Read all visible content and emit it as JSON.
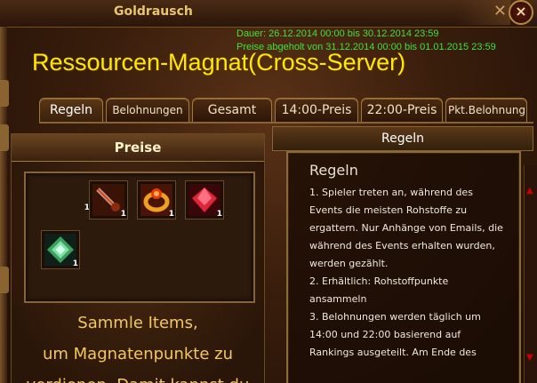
{
  "window": {
    "title": "Goldrausch",
    "period_line": "Dauer: 26.12.2014 00:00 bis 30.12.2014 23:59",
    "prize_claim_line": "Preise abgeholt von 31.12.2014 00:00 bis 01.01.2015 23:59",
    "headline": "Ressourcen-Magnat(Cross-Server)"
  },
  "tabs": [
    {
      "label": "Regeln",
      "active": true
    },
    {
      "label": "Belohnungen",
      "active": false
    },
    {
      "label": "Gesamt",
      "active": false
    },
    {
      "label": "14:00-Preis",
      "active": false
    },
    {
      "label": "22:00-Preis",
      "active": false
    },
    {
      "label": "Pkt.Belohnung",
      "active": false
    }
  ],
  "prizes": {
    "header": "Preise",
    "items": [
      {
        "icon": "sword-icon",
        "qty": "1"
      },
      {
        "icon": "sword-icon",
        "qty": "1"
      },
      {
        "icon": "ring-icon",
        "qty": "1"
      },
      {
        "icon": "red-gem-icon",
        "qty": "1"
      },
      {
        "icon": "green-gem-icon",
        "qty": "1"
      }
    ],
    "description_lines": [
      "Sammle Items,",
      "um Magnatenpunkte zu",
      "verdienen. Damit kannst du"
    ]
  },
  "rules": {
    "header": "Regeln",
    "title": "Regeln",
    "lines": [
      "1. Spieler treten an, während des",
      "Events die meisten Rohstoffe zu",
      "ergattern. Nur Anhänge von Emails, die",
      "während des Events erhalten wurden,",
      "werden gezählt.",
      "2. Erhältlich: Rohstoffpunkte",
      "ansammeln",
      "3. Belohnungen werden täglich um",
      "14:00 und 22:00 basierend auf",
      "Rankings ausgeteilt. Am Ende des"
    ]
  },
  "colors": {
    "headline": "#ffe800",
    "info_text": "#3fe03a",
    "accent_gold": "#e8c670"
  }
}
